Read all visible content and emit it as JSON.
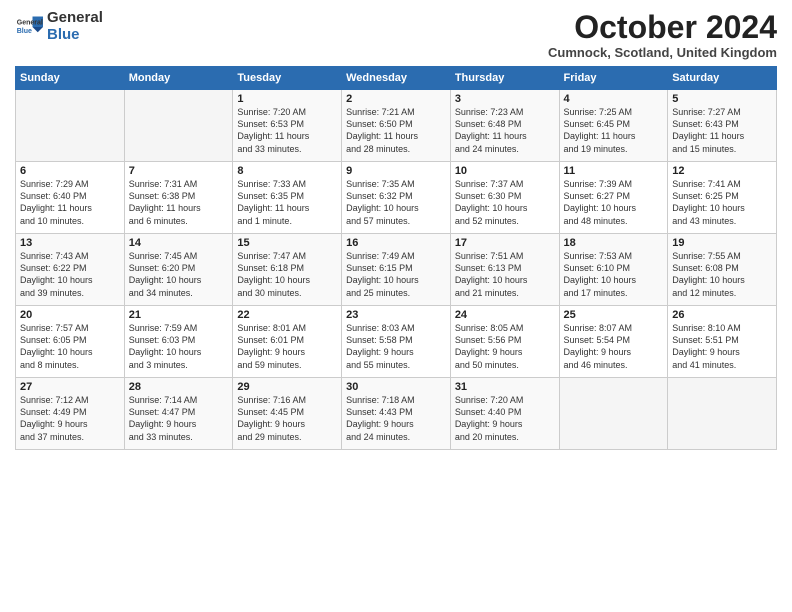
{
  "logo": {
    "general": "General",
    "blue": "Blue"
  },
  "title": "October 2024",
  "location": "Cumnock, Scotland, United Kingdom",
  "days_header": [
    "Sunday",
    "Monday",
    "Tuesday",
    "Wednesday",
    "Thursday",
    "Friday",
    "Saturday"
  ],
  "weeks": [
    [
      {
        "day": "",
        "info": ""
      },
      {
        "day": "",
        "info": ""
      },
      {
        "day": "1",
        "info": "Sunrise: 7:20 AM\nSunset: 6:53 PM\nDaylight: 11 hours\nand 33 minutes."
      },
      {
        "day": "2",
        "info": "Sunrise: 7:21 AM\nSunset: 6:50 PM\nDaylight: 11 hours\nand 28 minutes."
      },
      {
        "day": "3",
        "info": "Sunrise: 7:23 AM\nSunset: 6:48 PM\nDaylight: 11 hours\nand 24 minutes."
      },
      {
        "day": "4",
        "info": "Sunrise: 7:25 AM\nSunset: 6:45 PM\nDaylight: 11 hours\nand 19 minutes."
      },
      {
        "day": "5",
        "info": "Sunrise: 7:27 AM\nSunset: 6:43 PM\nDaylight: 11 hours\nand 15 minutes."
      }
    ],
    [
      {
        "day": "6",
        "info": "Sunrise: 7:29 AM\nSunset: 6:40 PM\nDaylight: 11 hours\nand 10 minutes."
      },
      {
        "day": "7",
        "info": "Sunrise: 7:31 AM\nSunset: 6:38 PM\nDaylight: 11 hours\nand 6 minutes."
      },
      {
        "day": "8",
        "info": "Sunrise: 7:33 AM\nSunset: 6:35 PM\nDaylight: 11 hours\nand 1 minute."
      },
      {
        "day": "9",
        "info": "Sunrise: 7:35 AM\nSunset: 6:32 PM\nDaylight: 10 hours\nand 57 minutes."
      },
      {
        "day": "10",
        "info": "Sunrise: 7:37 AM\nSunset: 6:30 PM\nDaylight: 10 hours\nand 52 minutes."
      },
      {
        "day": "11",
        "info": "Sunrise: 7:39 AM\nSunset: 6:27 PM\nDaylight: 10 hours\nand 48 minutes."
      },
      {
        "day": "12",
        "info": "Sunrise: 7:41 AM\nSunset: 6:25 PM\nDaylight: 10 hours\nand 43 minutes."
      }
    ],
    [
      {
        "day": "13",
        "info": "Sunrise: 7:43 AM\nSunset: 6:22 PM\nDaylight: 10 hours\nand 39 minutes."
      },
      {
        "day": "14",
        "info": "Sunrise: 7:45 AM\nSunset: 6:20 PM\nDaylight: 10 hours\nand 34 minutes."
      },
      {
        "day": "15",
        "info": "Sunrise: 7:47 AM\nSunset: 6:18 PM\nDaylight: 10 hours\nand 30 minutes."
      },
      {
        "day": "16",
        "info": "Sunrise: 7:49 AM\nSunset: 6:15 PM\nDaylight: 10 hours\nand 25 minutes."
      },
      {
        "day": "17",
        "info": "Sunrise: 7:51 AM\nSunset: 6:13 PM\nDaylight: 10 hours\nand 21 minutes."
      },
      {
        "day": "18",
        "info": "Sunrise: 7:53 AM\nSunset: 6:10 PM\nDaylight: 10 hours\nand 17 minutes."
      },
      {
        "day": "19",
        "info": "Sunrise: 7:55 AM\nSunset: 6:08 PM\nDaylight: 10 hours\nand 12 minutes."
      }
    ],
    [
      {
        "day": "20",
        "info": "Sunrise: 7:57 AM\nSunset: 6:05 PM\nDaylight: 10 hours\nand 8 minutes."
      },
      {
        "day": "21",
        "info": "Sunrise: 7:59 AM\nSunset: 6:03 PM\nDaylight: 10 hours\nand 3 minutes."
      },
      {
        "day": "22",
        "info": "Sunrise: 8:01 AM\nSunset: 6:01 PM\nDaylight: 9 hours\nand 59 minutes."
      },
      {
        "day": "23",
        "info": "Sunrise: 8:03 AM\nSunset: 5:58 PM\nDaylight: 9 hours\nand 55 minutes."
      },
      {
        "day": "24",
        "info": "Sunrise: 8:05 AM\nSunset: 5:56 PM\nDaylight: 9 hours\nand 50 minutes."
      },
      {
        "day": "25",
        "info": "Sunrise: 8:07 AM\nSunset: 5:54 PM\nDaylight: 9 hours\nand 46 minutes."
      },
      {
        "day": "26",
        "info": "Sunrise: 8:10 AM\nSunset: 5:51 PM\nDaylight: 9 hours\nand 41 minutes."
      }
    ],
    [
      {
        "day": "27",
        "info": "Sunrise: 7:12 AM\nSunset: 4:49 PM\nDaylight: 9 hours\nand 37 minutes."
      },
      {
        "day": "28",
        "info": "Sunrise: 7:14 AM\nSunset: 4:47 PM\nDaylight: 9 hours\nand 33 minutes."
      },
      {
        "day": "29",
        "info": "Sunrise: 7:16 AM\nSunset: 4:45 PM\nDaylight: 9 hours\nand 29 minutes."
      },
      {
        "day": "30",
        "info": "Sunrise: 7:18 AM\nSunset: 4:43 PM\nDaylight: 9 hours\nand 24 minutes."
      },
      {
        "day": "31",
        "info": "Sunrise: 7:20 AM\nSunset: 4:40 PM\nDaylight: 9 hours\nand 20 minutes."
      },
      {
        "day": "",
        "info": ""
      },
      {
        "day": "",
        "info": ""
      }
    ]
  ]
}
